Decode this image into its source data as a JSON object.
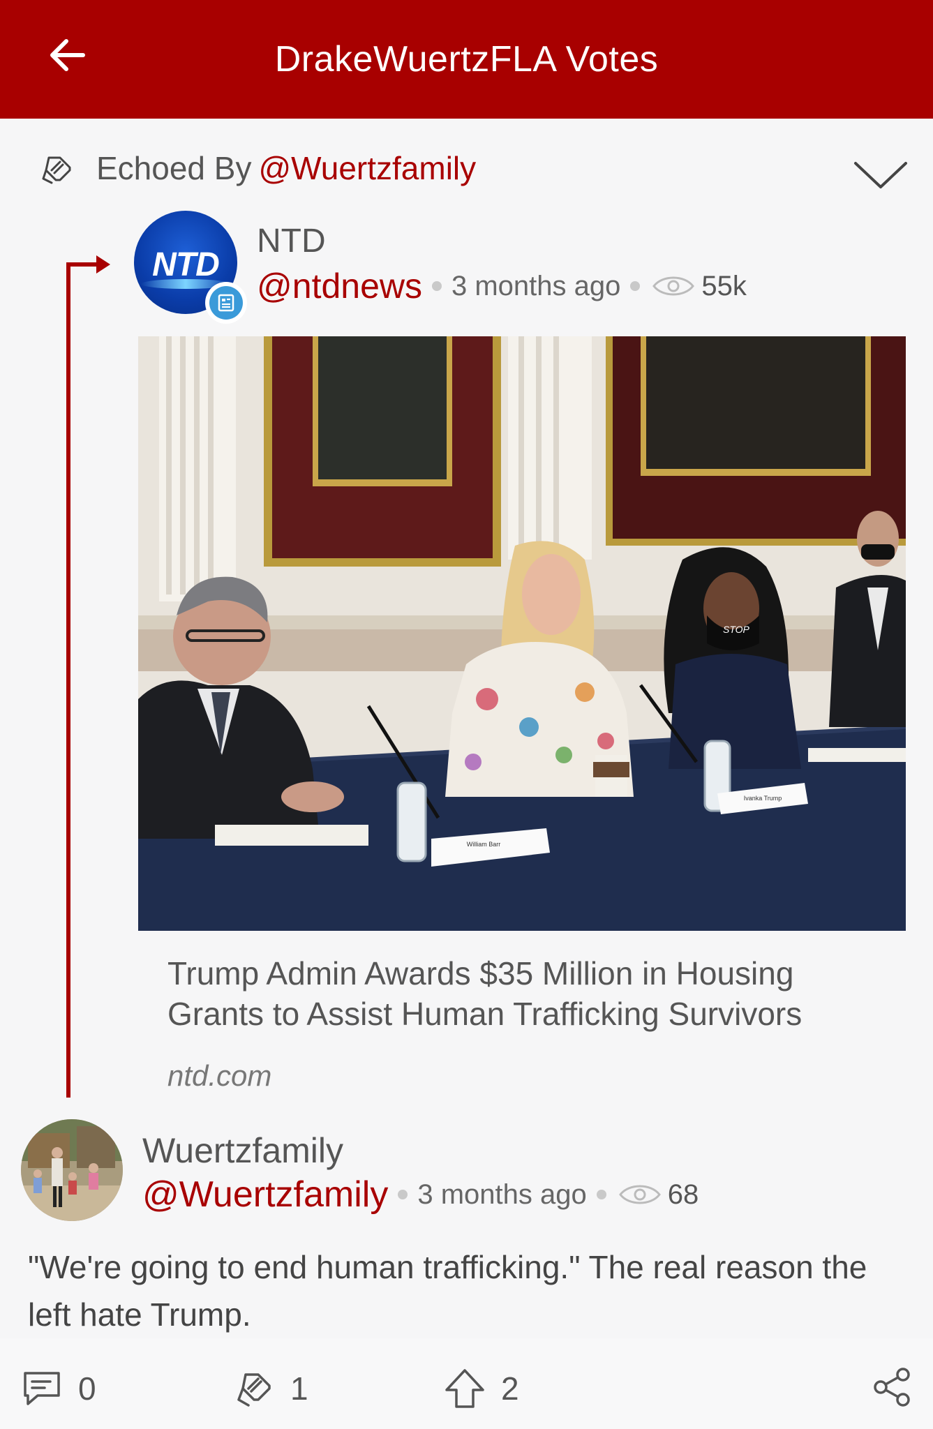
{
  "header": {
    "title": "DrakeWuertzFLA Votes",
    "back_icon": "back-arrow-icon"
  },
  "echo": {
    "prefix": "Echoed By",
    "handle": "@Wuertzfamily"
  },
  "original_post": {
    "author_name": "NTD",
    "avatar_text": "NTD",
    "handle": "@ntdnews",
    "time": "3 months ago",
    "views": "55k",
    "link_title": "Trump Admin Awards $35 Million in Housing Grants to Assist Human Trafficking Survivors",
    "link_domain": "ntd.com",
    "photo_placards": [
      "William Barr",
      "Ivanka Trump"
    ],
    "mask_text": "STOP"
  },
  "echo_post": {
    "author_name": "Wuertzfamily",
    "handle": "@Wuertzfamily",
    "time": "3 months ago",
    "views": "68",
    "text": "\"We're going to end human trafficking.\" The real reason the left hate Trump."
  },
  "actions": {
    "comments": "0",
    "echoes": "1",
    "votes": "2"
  },
  "colors": {
    "accent": "#a80000",
    "header_bg": "#a80000",
    "page_bg": "#f6f6f7"
  }
}
